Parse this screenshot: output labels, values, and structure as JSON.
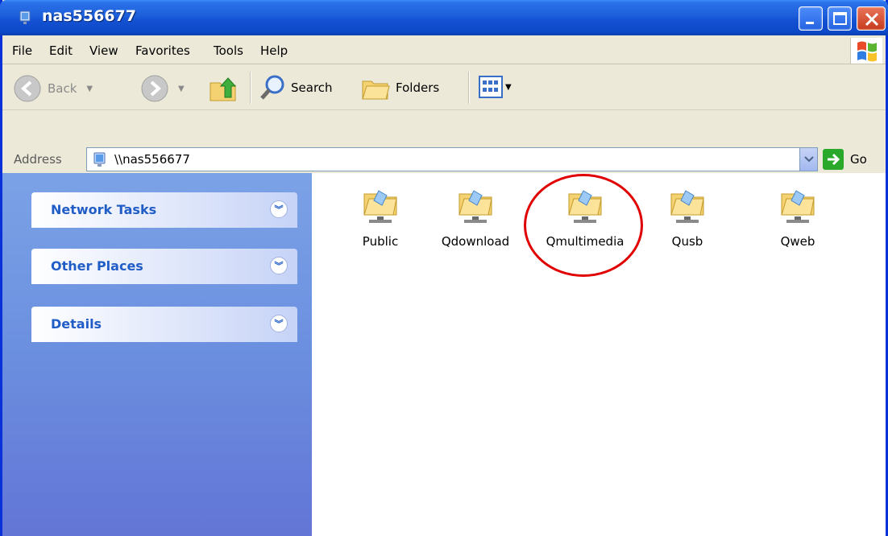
{
  "window": {
    "title": "nas556677",
    "title_icon": "network-computer-icon"
  },
  "menu": {
    "items": [
      {
        "label": "File"
      },
      {
        "label": "Edit"
      },
      {
        "label": "View"
      },
      {
        "label": "Favorites"
      },
      {
        "label": "Tools"
      },
      {
        "label": "Help"
      }
    ]
  },
  "toolbar": {
    "back_label": "Back",
    "search_label": "Search",
    "folders_label": "Folders"
  },
  "address": {
    "label": "Address",
    "value": "\\\\nas556677",
    "go_label": "Go"
  },
  "tasks": [
    {
      "label": "Network Tasks"
    },
    {
      "label": "Other Places"
    },
    {
      "label": "Details"
    }
  ],
  "shares": [
    {
      "label": "Public"
    },
    {
      "label": "Qdownload"
    },
    {
      "label": "Qmultimedia",
      "highlighted": true
    },
    {
      "label": "Qusb"
    },
    {
      "label": "Qweb"
    }
  ],
  "colors": {
    "titlebar": "#1453d4",
    "leftpane_top": "#7ba2e7",
    "task_label": "#215dc6",
    "highlight": "#e00000"
  }
}
